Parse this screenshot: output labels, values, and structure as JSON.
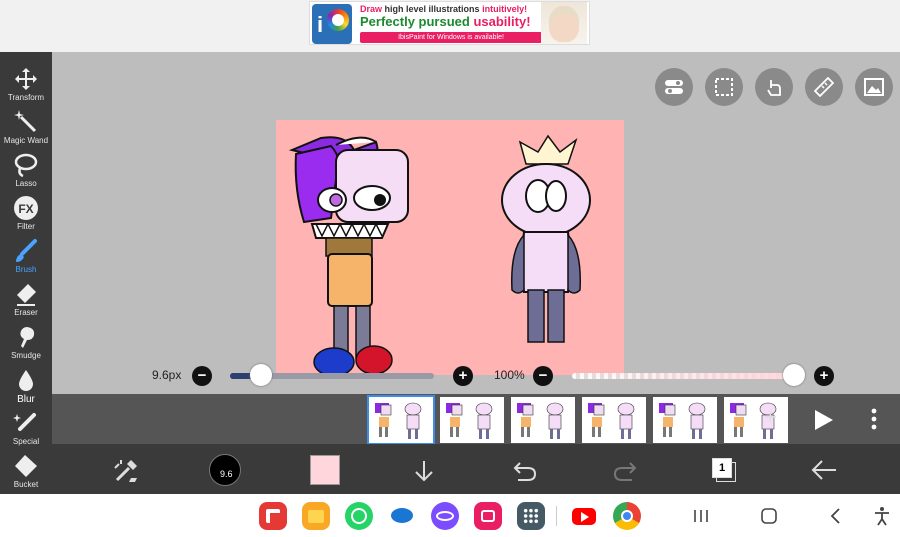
{
  "ad": {
    "line1_a": "Draw",
    "line1_b": "high level illustrations",
    "line1_c": "intuitively!",
    "line2_a": "Perfectly pursued",
    "line2_b": "usability!",
    "line3": "IbisPaint for Windows is available!"
  },
  "tools": [
    {
      "label": "Transform",
      "icon": "move-arrows-icon"
    },
    {
      "label": "Magic Wand",
      "icon": "magic-wand-icon"
    },
    {
      "label": "Lasso",
      "icon": "lasso-icon"
    },
    {
      "label": "Filter",
      "icon": "fx-icon",
      "glyph": "FX"
    },
    {
      "label": "Brush",
      "icon": "brush-icon",
      "active": true
    },
    {
      "label": "Eraser",
      "icon": "eraser-icon"
    },
    {
      "label": "Smudge",
      "icon": "smudge-icon"
    },
    {
      "label": "Blur",
      "icon": "blur-drop-icon"
    },
    {
      "label": "Special",
      "icon": "special-pen-icon"
    },
    {
      "label": "Bucket",
      "icon": "bucket-icon"
    }
  ],
  "top_icons": [
    "toggle-panel-icon",
    "selection-icon",
    "hand-pointer-icon",
    "ruler-icon",
    "image-icon"
  ],
  "brush": {
    "size_label": "9.6px",
    "size_fraction": 0.15,
    "opacity_label": "100%",
    "opacity_fraction": 1.0
  },
  "frames": {
    "count": 6,
    "selected_index": 0,
    "add_label": "+"
  },
  "bottom": {
    "brush_size_badge": "9.6",
    "color_hex": "#ffd6dc",
    "layer_count": "1"
  },
  "colors": {
    "canvas_bg": "#ffb3b3",
    "accent": "#4aa3ff",
    "workspace": "#bdbdbd",
    "toolbar": "#3a3a3a"
  },
  "dock_apps": [
    "flipboard-icon",
    "files-icon",
    "whatsapp-icon",
    "messages-icon",
    "internet-icon",
    "gallery-icon",
    "app-grid-icon",
    "youtube-icon",
    "chrome-icon"
  ]
}
